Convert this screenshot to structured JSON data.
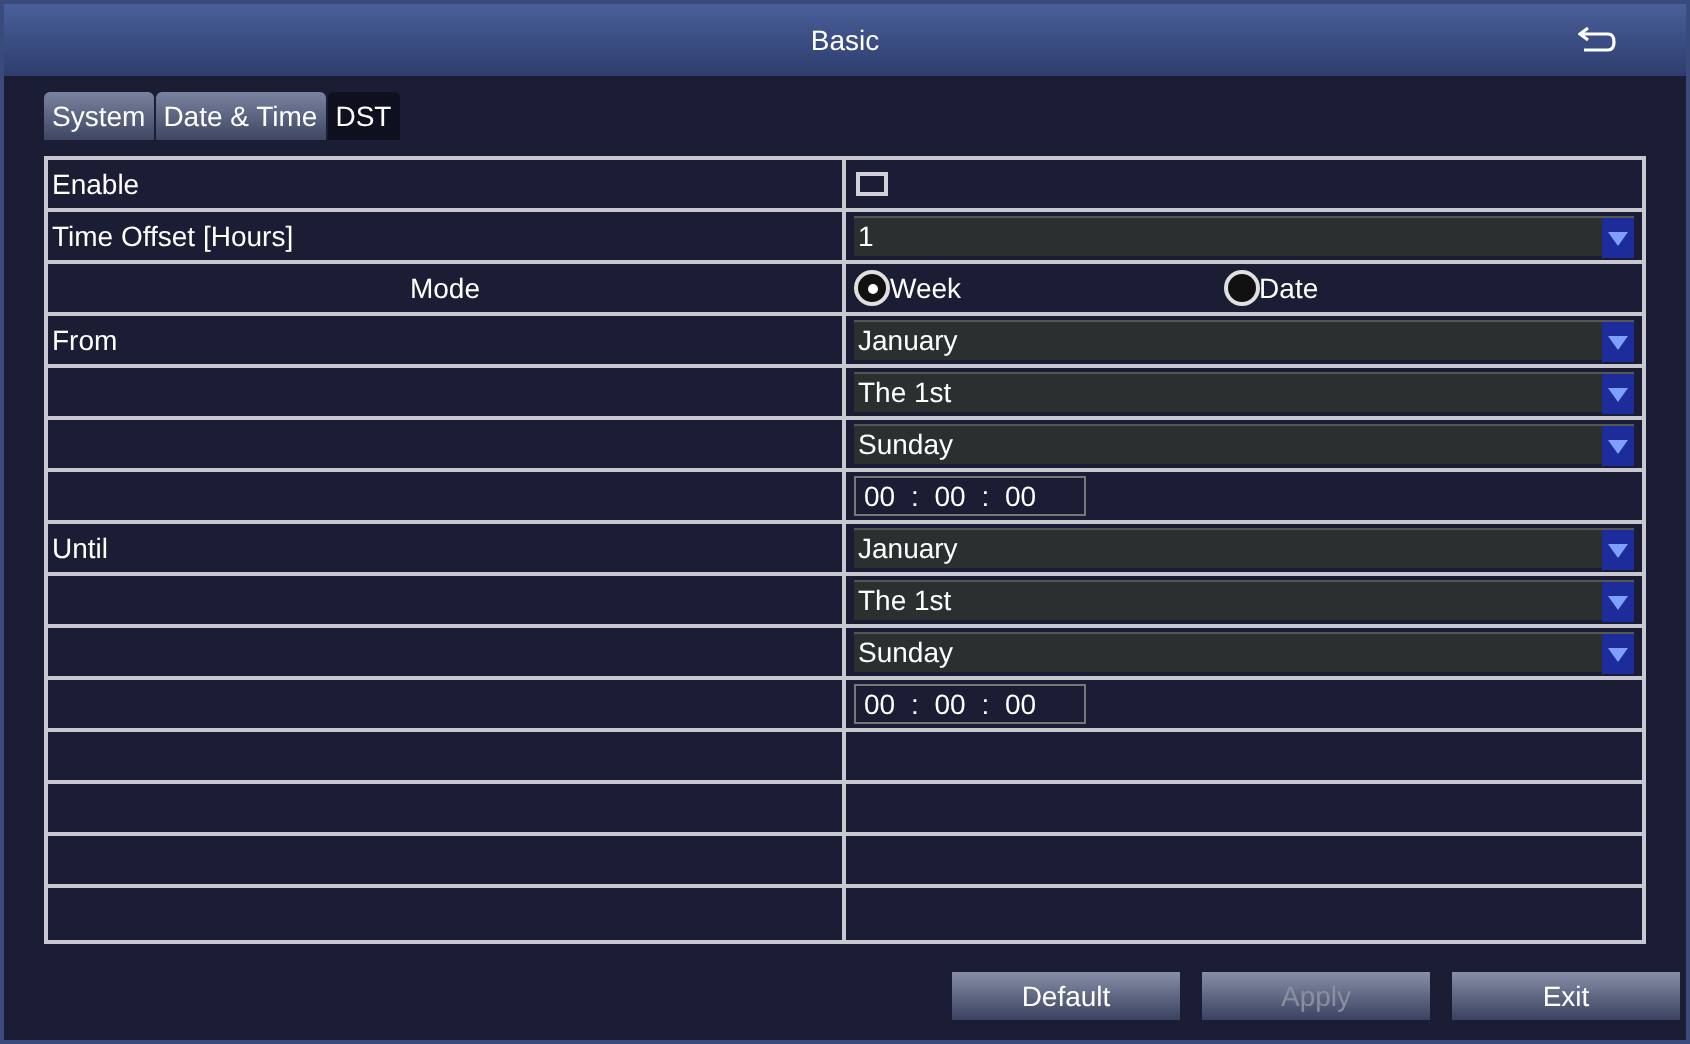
{
  "window": {
    "title": "Basic"
  },
  "tabs": [
    {
      "label": "System",
      "selected": false
    },
    {
      "label": "Date & Time",
      "selected": false
    },
    {
      "label": "DST",
      "selected": true
    }
  ],
  "rows": [
    {
      "kind": "checkbox",
      "label": "Enable",
      "checked": false
    },
    {
      "kind": "select",
      "label": "Time Offset [Hours]",
      "value": "1"
    },
    {
      "kind": "radio",
      "label": "Mode",
      "options": [
        {
          "label": "Week",
          "selected": true
        },
        {
          "label": "Date",
          "selected": false
        }
      ]
    },
    {
      "kind": "select",
      "label": "From",
      "value": "January"
    },
    {
      "kind": "select",
      "value": "The 1st"
    },
    {
      "kind": "select",
      "value": "Sunday"
    },
    {
      "kind": "time",
      "value": "00 : 00 : 00"
    },
    {
      "kind": "select",
      "label": "Until",
      "value": "January"
    },
    {
      "kind": "select",
      "value": "The 1st"
    },
    {
      "kind": "select",
      "value": "Sunday"
    },
    {
      "kind": "time",
      "value": "00 : 00 : 00"
    },
    {
      "kind": "blank"
    },
    {
      "kind": "blank"
    },
    {
      "kind": "blank"
    },
    {
      "kind": "blank"
    }
  ],
  "buttons": [
    {
      "label": "Default",
      "disabled": false
    },
    {
      "label": "Apply",
      "disabled": true
    },
    {
      "label": "Exit",
      "disabled": false
    }
  ]
}
